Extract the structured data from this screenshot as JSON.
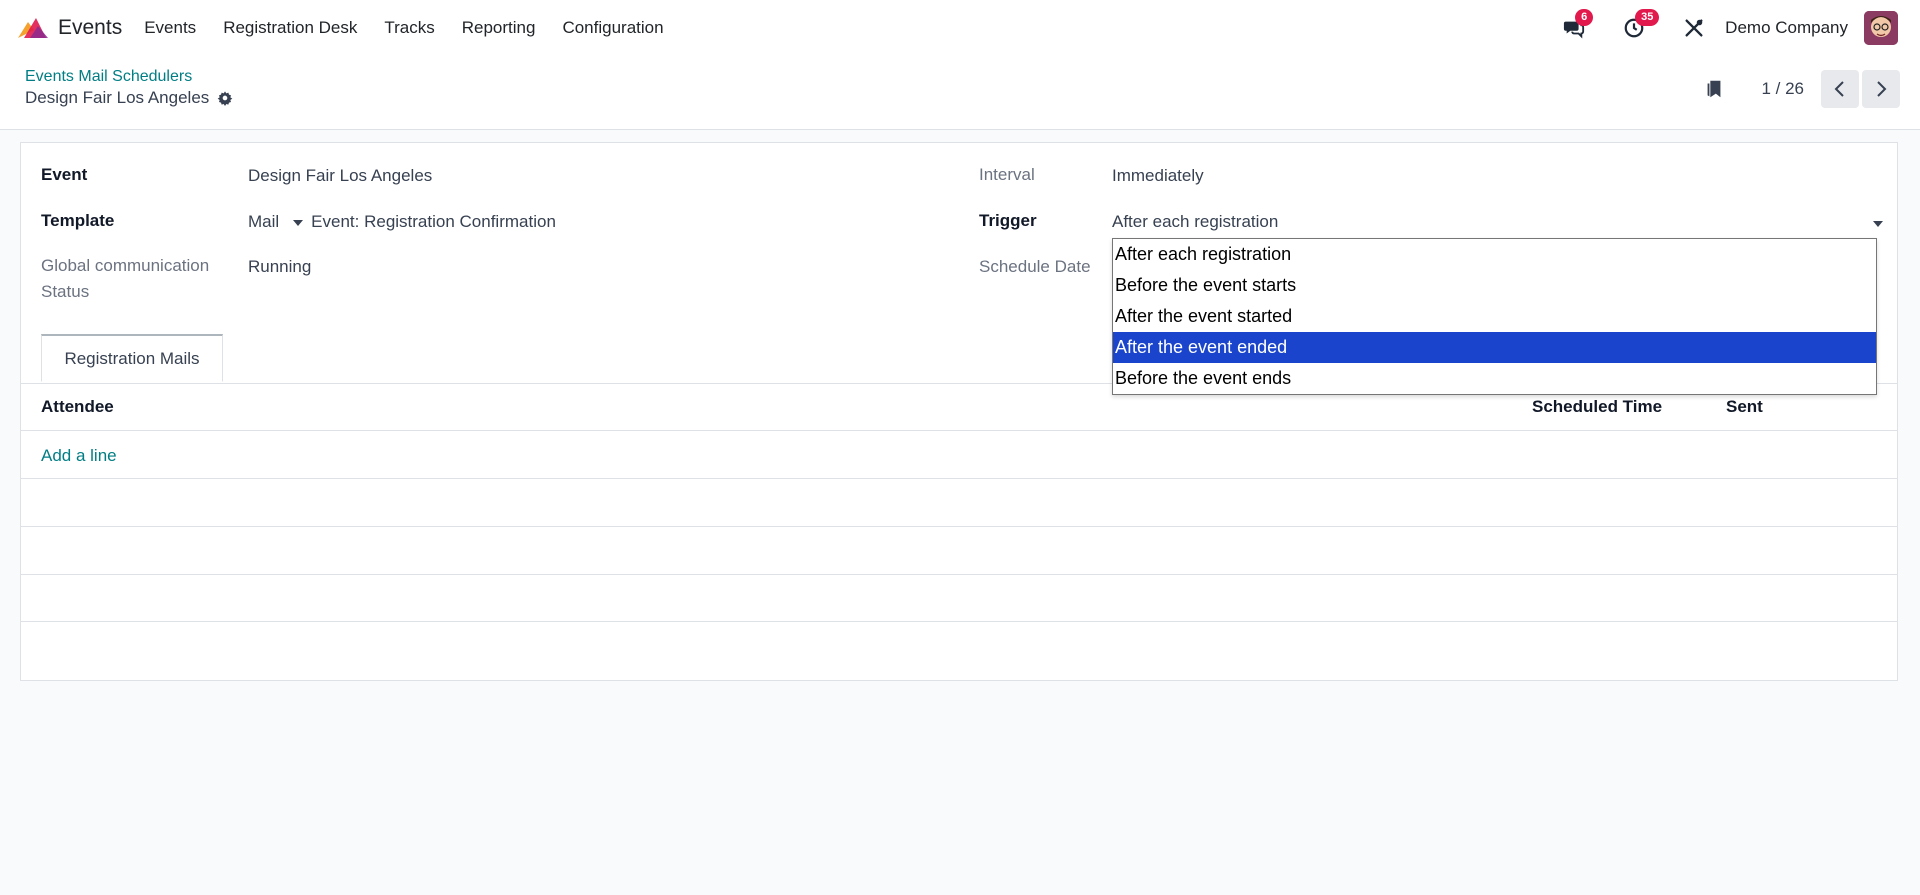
{
  "navbar": {
    "app_name": "Events",
    "menu": [
      "Events",
      "Registration Desk",
      "Tracks",
      "Reporting",
      "Configuration"
    ],
    "messages_badge": "6",
    "activities_badge": "35",
    "company": "Demo Company"
  },
  "control_panel": {
    "breadcrumb": "Events Mail Schedulers",
    "record_title": "Design Fair Los Angeles",
    "pager": "1 / 26"
  },
  "form": {
    "event_label": "Event",
    "event_value": "Design Fair Los Angeles",
    "template_label": "Template",
    "template_type": "Mail",
    "template_value": "Event: Registration Confirmation",
    "status_label_1": "Global communication",
    "status_label_2": "Status",
    "status_value": "Running",
    "interval_label": "Interval",
    "interval_value": "Immediately",
    "trigger_label": "Trigger",
    "trigger_value": "After each registration",
    "schedule_date_label": "Schedule Date"
  },
  "tabs": {
    "registration_mails": "Registration Mails"
  },
  "list": {
    "columns": {
      "attendee": "Attendee",
      "scheduled_time": "Scheduled Time",
      "sent": "Sent"
    },
    "add_line": "Add a line"
  },
  "trigger_dropdown": {
    "options": [
      "After each registration",
      "Before the event starts",
      "After the event started",
      "After the event ended",
      "Before the event ends"
    ],
    "highlighted_index": 3
  },
  "colors": {
    "accent": "#017e84",
    "badge": "#e1194d",
    "highlight": "#1a44cc"
  }
}
